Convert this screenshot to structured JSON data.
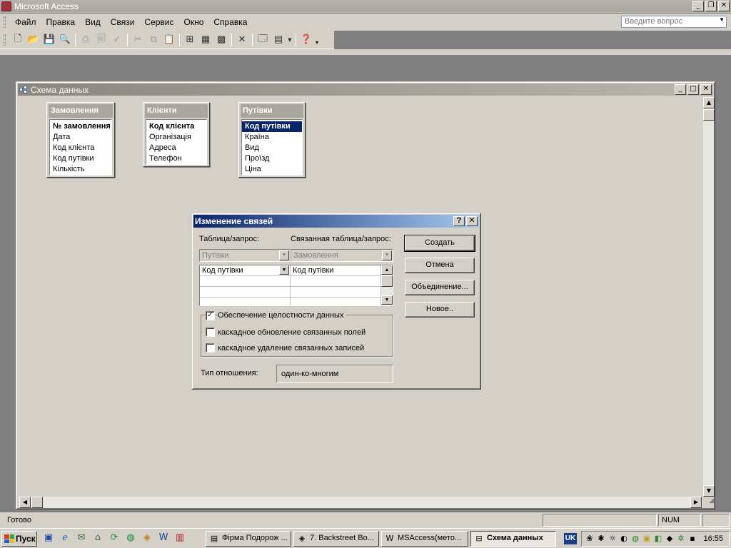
{
  "app": {
    "title": "Microsoft Access"
  },
  "menu": [
    "Файл",
    "Правка",
    "Вид",
    "Связи",
    "Сервис",
    "Окно",
    "Справка"
  ],
  "help_box": {
    "placeholder": "Введите вопрос"
  },
  "child_window": {
    "title": "Схема данных"
  },
  "tables": [
    {
      "name": "Замовлення",
      "fields": [
        "№ замовлення",
        "Дата",
        "Код клієнта",
        "Код путівки",
        "Кількість"
      ],
      "key_index": 0,
      "selected_index": -1
    },
    {
      "name": "Клієнти",
      "fields": [
        "Код клієнта",
        "Організація",
        "Адреса",
        "Телефон"
      ],
      "key_index": 0,
      "selected_index": -1
    },
    {
      "name": "Путівки",
      "fields": [
        "Код путівки",
        "Країна",
        "Вид",
        "Проїзд",
        "Ціна"
      ],
      "key_index": 0,
      "selected_index": 0
    }
  ],
  "dialog": {
    "title": "Изменение связей",
    "help_btn": "?",
    "close_btn": "✕",
    "table_label": "Таблица/запрос:",
    "related_label": "Связанная таблица/запрос:",
    "table_value": "Путівки",
    "related_value": "Замовлення",
    "grid_rows": [
      {
        "left": "Код путівки",
        "right": "Код путівки"
      }
    ],
    "buttons": {
      "create": "Создать",
      "cancel": "Отмена",
      "join": "Объединение...",
      "new": "Новое.."
    },
    "integrity": {
      "label": "Обеспечение целостности данных",
      "checked": true
    },
    "cascade_update": {
      "label": "каскадное обновление связанных полей",
      "checked": false
    },
    "cascade_delete": {
      "label": "каскадное удаление связанных записей",
      "checked": false
    },
    "relation_type_label": "Тип отношения:",
    "relation_type_value": "один-ко-многим"
  },
  "status": {
    "text": "Готово",
    "num": "NUM"
  },
  "taskbar": {
    "start": "Пуск",
    "tasks": [
      "Фірма Подорож ...",
      "7. Backstreet Bo...",
      "MSAccess(мето...",
      "Схема данных"
    ],
    "active_task_index": 3,
    "lang": "UK",
    "clock": "16:55"
  }
}
